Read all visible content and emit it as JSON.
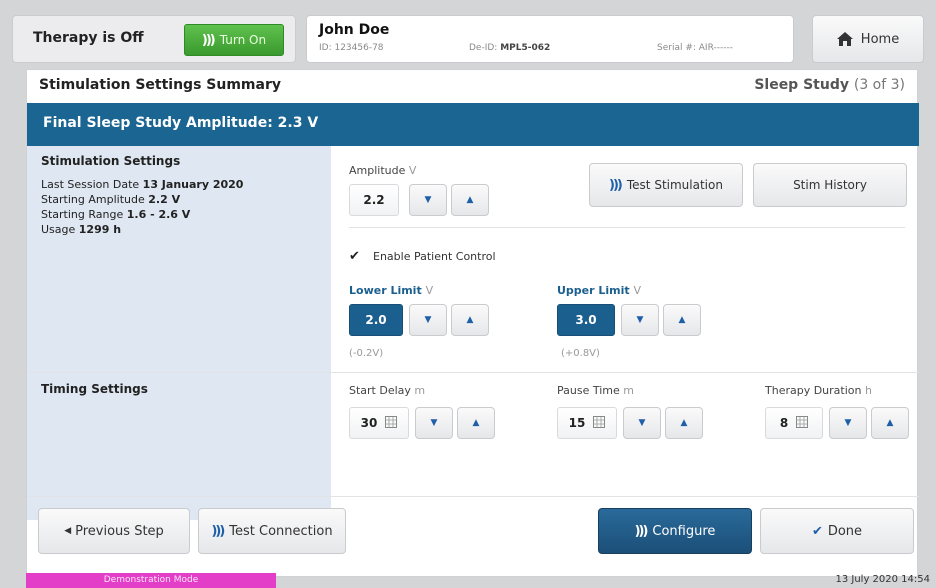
{
  "header": {
    "therapy_status": "Therapy is Off",
    "turn_on_label": "Turn On",
    "patient_name": "John Doe",
    "patient_id": "ID: 123456-78",
    "deid_label": "De-ID:",
    "deid_value": "MPL5-062",
    "serial": "Serial #: AIR------",
    "home_label": "Home"
  },
  "panel": {
    "title": "Stimulation Settings Summary",
    "step_name": "Sleep Study",
    "step_count": "(3 of 3)",
    "banner": "Final Sleep Study Amplitude: 2.3 V"
  },
  "stim_summary": {
    "title": "Stimulation Settings",
    "last_session_label": "Last Session Date",
    "last_session_value": "13 January 2020",
    "starting_amp_label": "Starting Amplitude",
    "starting_amp_value": "2.2 V",
    "starting_range_label": "Starting Range",
    "starting_range_value": "1.6  -  2.6 V",
    "usage_label": "Usage",
    "usage_value": "1299 h"
  },
  "amplitude": {
    "label": "Amplitude",
    "unit": "V",
    "value": "2.2"
  },
  "buttons": {
    "test_stimulation": "Test Stimulation",
    "stim_history": "Stim History"
  },
  "patient_control": {
    "label": "Enable Patient Control",
    "checked": true
  },
  "lower_limit": {
    "label": "Lower Limit",
    "unit": "V",
    "value": "2.0",
    "hint": "(-0.2V)"
  },
  "upper_limit": {
    "label": "Upper Limit",
    "unit": "V",
    "value": "3.0",
    "hint": "(+0.8V)"
  },
  "timing": {
    "title": "Timing Settings",
    "start_delay": {
      "label": "Start Delay",
      "unit": "m",
      "value": "30"
    },
    "pause_time": {
      "label": "Pause Time",
      "unit": "m",
      "value": "15"
    },
    "therapy_duration": {
      "label": "Therapy Duration",
      "unit": "h",
      "value": "8"
    }
  },
  "footer": {
    "previous_step": "Previous Step",
    "test_connection": "Test Connection",
    "configure": "Configure",
    "done": "Done",
    "demo_mode": "Demonstration Mode",
    "datetime": "13 July 2020 14:54"
  },
  "colors": {
    "banner": "#1b6593",
    "turn_on": "#3a9a2e",
    "configure": "#1b4f78",
    "demo": "#e23ec7",
    "left_column": "#dfe8f2"
  },
  "icons": [
    "wave-icon",
    "home-icon",
    "checkmark-icon",
    "calculator-icon",
    "arrow-up-icon",
    "arrow-down-icon",
    "arrow-left-icon"
  ]
}
